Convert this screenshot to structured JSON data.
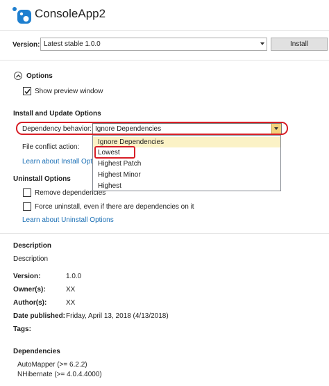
{
  "header": {
    "title": "ConsoleApp2"
  },
  "version_row": {
    "label": "Version:",
    "selected": "Latest stable 1.0.0",
    "install_label": "Install"
  },
  "options": {
    "heading": "Options",
    "show_preview": {
      "label": "Show preview window",
      "checked": true
    }
  },
  "install_update": {
    "heading": "Install and Update Options",
    "dependency_label": "Dependency behavior:",
    "dependency_value": "Ignore Dependencies",
    "file_conflict_label": "File conflict action:",
    "learn_link": "Learn about Install Optio",
    "dropdown_options": [
      "Ignore Dependencies",
      "Lowest",
      "Highest Patch",
      "Highest Minor",
      "Highest"
    ]
  },
  "uninstall": {
    "heading": "Uninstall Options",
    "remove_deps": "Remove dependencies",
    "force": "Force uninstall, even if there are dependencies on it",
    "learn_link": "Learn about Uninstall Options"
  },
  "description": {
    "heading": "Description",
    "text": "Description",
    "version_label": "Version:",
    "version_value": "1.0.0",
    "owners_label": "Owner(s):",
    "owners_value": "XX",
    "authors_label": "Author(s):",
    "authors_value": "XX",
    "date_label": "Date published:",
    "date_value": "Friday, April 13, 2018 (4/13/2018)",
    "tags_label": "Tags:"
  },
  "dependencies": {
    "heading": "Dependencies",
    "items": [
      "AutoMapper (>= 6.2.2)",
      "NHibernate (>= 4.0.4.4000)"
    ]
  },
  "colors": {
    "highlight": "#d71e26",
    "link": "#1a6fb5",
    "selected_item": "#fbf2c6"
  }
}
